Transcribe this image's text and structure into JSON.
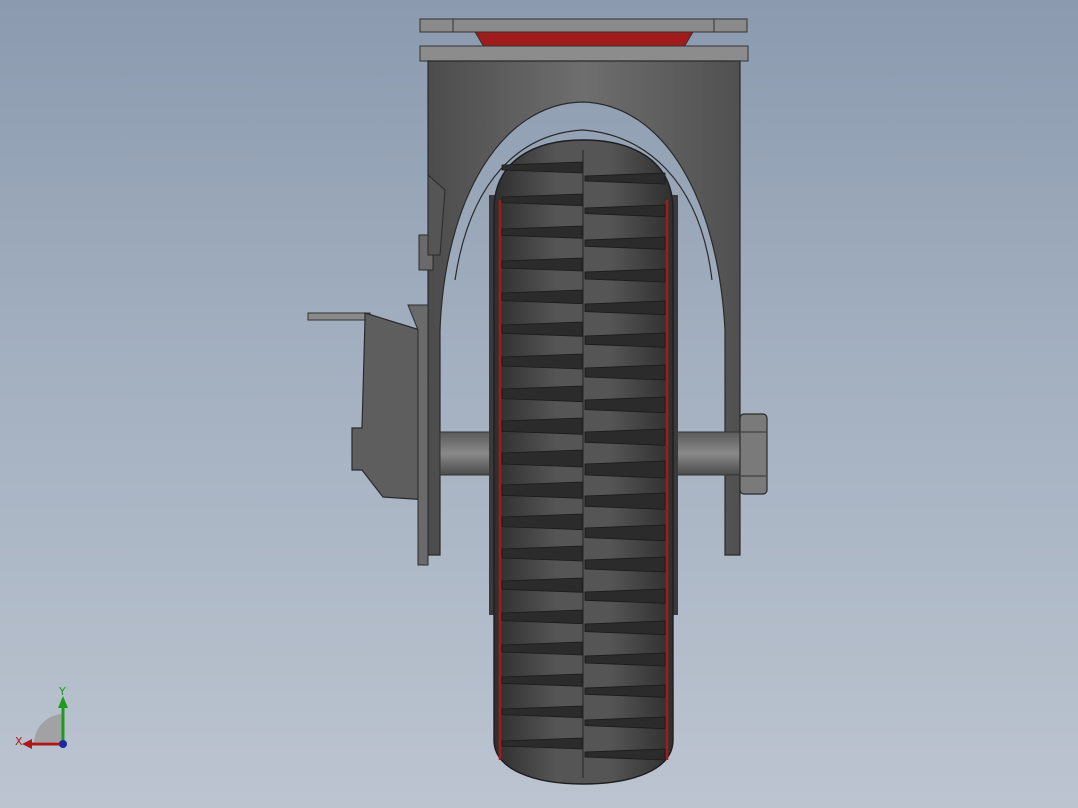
{
  "viewport": {
    "background_top": "#8b9aaf",
    "background_bottom": "#bcc4d0"
  },
  "model": {
    "part": "caster-wheel-with-brake",
    "body_color": "#5f5f5f",
    "tread_color": "#3a3a3a",
    "accent_color": "#a01c1c"
  },
  "triad": {
    "x_label": "X",
    "y_label": "Y",
    "x_color": "#b01818",
    "y_color": "#1e9a1e",
    "z_color": "#1a2aa0"
  }
}
